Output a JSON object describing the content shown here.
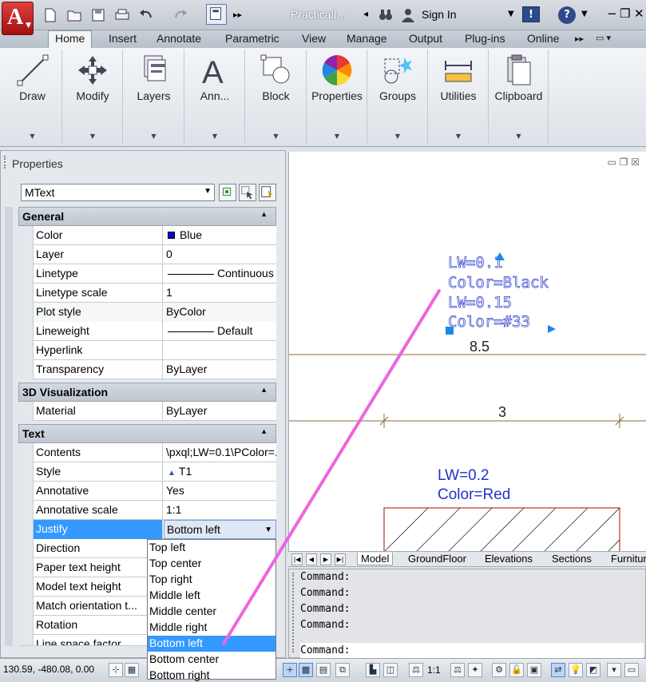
{
  "titlebar": {
    "app_letter": "A",
    "title": "PracticalI...",
    "sign_in": "Sign In",
    "exchange_label": "!",
    "help_label": "?",
    "min": "−",
    "restore": "❐",
    "close": "✕"
  },
  "ribbon_tabs": [
    "Home",
    "Insert",
    "Annotate",
    "Parametric",
    "View",
    "Manage",
    "Output",
    "Plug-ins",
    "Online"
  ],
  "ribbon_panels": [
    "Draw",
    "Modify",
    "Layers",
    "Ann...",
    "Block",
    "Properties",
    "Groups",
    "Utilities",
    "Clipboard"
  ],
  "properties": {
    "title": "Properties",
    "object_type": "MText",
    "categories": {
      "general": "General",
      "viz3d": "3D Visualization",
      "text": "Text"
    },
    "general_rows": [
      {
        "key": "Color",
        "value": "Blue"
      },
      {
        "key": "Layer",
        "value": "0"
      },
      {
        "key": "Linetype",
        "value": "Continuous"
      },
      {
        "key": "Linetype scale",
        "value": "1"
      },
      {
        "key": "Plot style",
        "value": "ByColor"
      },
      {
        "key": "Lineweight",
        "value": "Default"
      },
      {
        "key": "Hyperlink",
        "value": ""
      },
      {
        "key": "Transparency",
        "value": "ByLayer"
      }
    ],
    "viz_rows": [
      {
        "key": "Material",
        "value": "ByLayer"
      }
    ],
    "text_rows": [
      {
        "key": "Contents",
        "value": "\\pxql;LW=0.1\\PColor=..."
      },
      {
        "key": "Style",
        "value": "T1"
      },
      {
        "key": "Annotative",
        "value": "Yes"
      },
      {
        "key": "Annotative scale",
        "value": "1:1"
      },
      {
        "key": "Justify",
        "value": "Bottom left"
      },
      {
        "key": "Direction",
        "value": ""
      },
      {
        "key": "Paper text height",
        "value": ""
      },
      {
        "key": "Model text height",
        "value": ""
      },
      {
        "key": "Match orientation t...",
        "value": ""
      },
      {
        "key": "Rotation",
        "value": ""
      },
      {
        "key": "Line space factor",
        "value": ""
      }
    ],
    "justify_options": [
      "Top left",
      "Top center",
      "Top right",
      "Middle left",
      "Middle center",
      "Middle right",
      "Bottom left",
      "Bottom center",
      "Bottom right"
    ],
    "justify_selected": "Bottom left"
  },
  "drawing": {
    "mtext_lines": [
      "LW=0.1",
      "Color=Black",
      "LW=0.15",
      "Color=#33"
    ],
    "dim_upper": "8.5",
    "dim_lower": "3",
    "red_text_line1": "LW=0.2",
    "red_text_line2": "Color=Red",
    "colors": {
      "blue_text": "#2233cc",
      "red_box": "#c03030",
      "annotation_arrow": "#ee66dd",
      "dim_line": "#8b6b3a",
      "grip": "#1e88e5"
    }
  },
  "layout_tabs": [
    "Model",
    "GroundFloor",
    "Elevations",
    "Sections",
    "Furnitur"
  ],
  "command": {
    "history": [
      "Command:",
      "Command:",
      "Command:",
      "Command:"
    ],
    "prompt": "Command:"
  },
  "status": {
    "coords": "130.59, -480.08, 0.00",
    "annotation_scale": "1:1"
  }
}
